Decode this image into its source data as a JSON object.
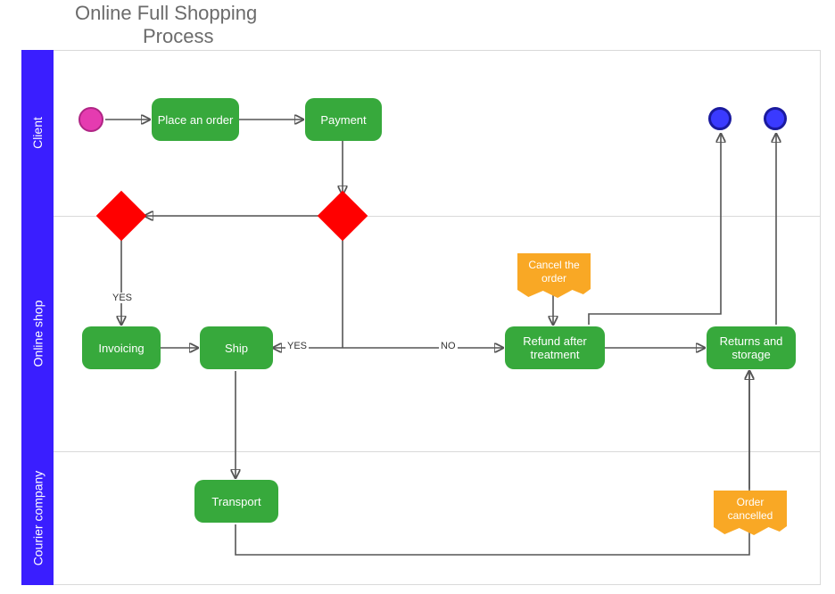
{
  "title_line1": "Online Full Shopping",
  "title_line2": "Process",
  "lanes": {
    "client": "Client",
    "shop": "Online shop",
    "courier": "Courier company"
  },
  "nodes": {
    "place_order": "Place an order",
    "payment": "Payment",
    "invoicing": "Invoicing",
    "ship": "Ship",
    "refund": "Refund after treatment",
    "returns": "Returns and storage",
    "transport": "Transport",
    "cancel_doc": "Cancel the order",
    "cancelled_doc": "Order cancelled"
  },
  "edge_labels": {
    "yes1": "YES",
    "yes2": "YES",
    "no": "NO"
  },
  "chart_data": {
    "type": "swimlane-flowchart",
    "title": "Online Full Shopping Process",
    "lanes": [
      "Client",
      "Online shop",
      "Courier company"
    ],
    "elements": [
      {
        "id": "start",
        "type": "start-event",
        "lane": "Client"
      },
      {
        "id": "place_order",
        "type": "task",
        "lane": "Client",
        "label": "Place an order"
      },
      {
        "id": "payment",
        "type": "task",
        "lane": "Client",
        "label": "Payment"
      },
      {
        "id": "gw1",
        "type": "gateway",
        "lane": "Client/Online shop"
      },
      {
        "id": "gw2",
        "type": "gateway",
        "lane": "Client/Online shop"
      },
      {
        "id": "invoicing",
        "type": "task",
        "lane": "Online shop",
        "label": "Invoicing"
      },
      {
        "id": "ship",
        "type": "task",
        "lane": "Online shop",
        "label": "Ship"
      },
      {
        "id": "cancel_doc",
        "type": "document",
        "lane": "Online shop",
        "label": "Cancel the order"
      },
      {
        "id": "refund",
        "type": "task",
        "lane": "Online shop",
        "label": "Refund after treatment"
      },
      {
        "id": "returns",
        "type": "task",
        "lane": "Online shop",
        "label": "Returns and storage"
      },
      {
        "id": "transport",
        "type": "task",
        "lane": "Courier company",
        "label": "Transport"
      },
      {
        "id": "cancelled_doc",
        "type": "document",
        "lane": "Courier company",
        "label": "Order cancelled"
      },
      {
        "id": "end1",
        "type": "end-event",
        "lane": "Client"
      },
      {
        "id": "end2",
        "type": "end-event",
        "lane": "Client"
      }
    ],
    "flows": [
      {
        "from": "start",
        "to": "place_order"
      },
      {
        "from": "place_order",
        "to": "payment"
      },
      {
        "from": "payment",
        "to": "gw1"
      },
      {
        "from": "gw1",
        "to": "gw2"
      },
      {
        "from": "gw2",
        "to": "invoicing",
        "label": "YES"
      },
      {
        "from": "invoicing",
        "to": "ship"
      },
      {
        "from": "gw1",
        "to": "ship",
        "label": "YES"
      },
      {
        "from": "gw1",
        "to": "refund",
        "label": "NO"
      },
      {
        "from": "cancel_doc",
        "to": "refund"
      },
      {
        "from": "refund",
        "to": "returns"
      },
      {
        "from": "ship",
        "to": "transport"
      },
      {
        "from": "transport",
        "to": "returns"
      },
      {
        "from": "cancelled_doc",
        "to": "returns"
      },
      {
        "from": "returns",
        "to": "end2"
      },
      {
        "from": "refund",
        "to": "end1"
      }
    ]
  }
}
